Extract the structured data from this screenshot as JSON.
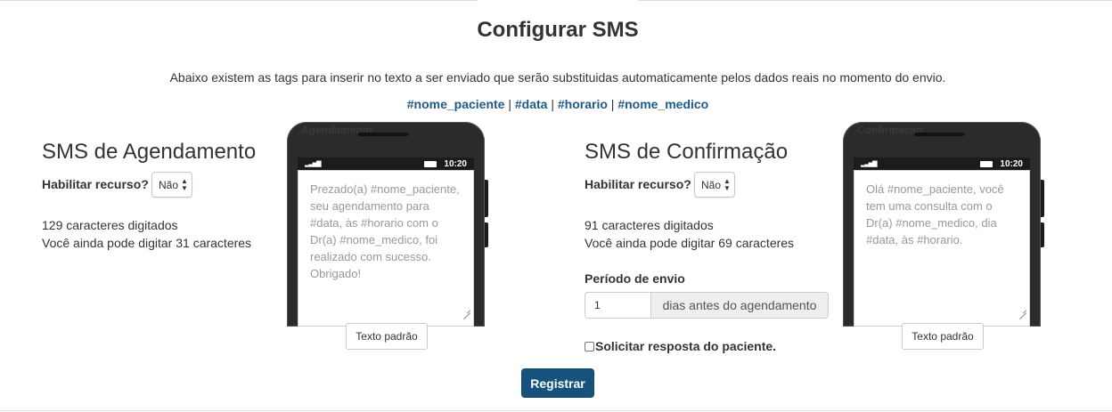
{
  "page": {
    "title": "Configurar SMS",
    "intro": "Abaixo existem as tags para inserir no texto a ser enviado que serão substituidas automaticamente pelos dados reais no momento do envio.",
    "tags": [
      "#nome_paciente",
      "#data",
      "#horario",
      "#nome_medico"
    ],
    "tag_separator": " | "
  },
  "scheduling": {
    "title": "SMS de Agendamento",
    "enable_label": "Habilitar recurso?",
    "enable_value": "Não",
    "typed_count": "129 caracteres digitados",
    "remaining": "Você ainda pode digitar 31 caracteres",
    "phone_label": "Agendamento",
    "status_time": "10:20",
    "message": "Prezado(a) #nome_paciente, seu agendamento para #data, às #horario com o Dr(a) #nome_medico, foi realizado com sucesso. Obrigado!",
    "default_button": "Texto padrão"
  },
  "confirmation": {
    "title": "SMS de Confirmação",
    "enable_label": "Habilitar recurso?",
    "enable_value": "Não",
    "typed_count": "91 caracteres digitados",
    "remaining": "Você ainda pode digitar 69 caracteres",
    "period_label": "Período de envio",
    "period_value": "1",
    "period_addon": "dias antes do agendamento",
    "reply_label": "Solicitar resposta do paciente.",
    "reply_checked": false,
    "phone_label": "Confirmação",
    "status_time": "10:20",
    "message": "Olá #nome_paciente, você tem uma consulta com o Dr(a) #nome_medico, dia #data, às #horario.",
    "default_button": "Texto padrão"
  },
  "submit_label": "Registrar",
  "colors": {
    "primary": "#17527e",
    "tag_link": "#1e5a8a",
    "phone_body": "#2b2b2b",
    "text": "#333333"
  }
}
